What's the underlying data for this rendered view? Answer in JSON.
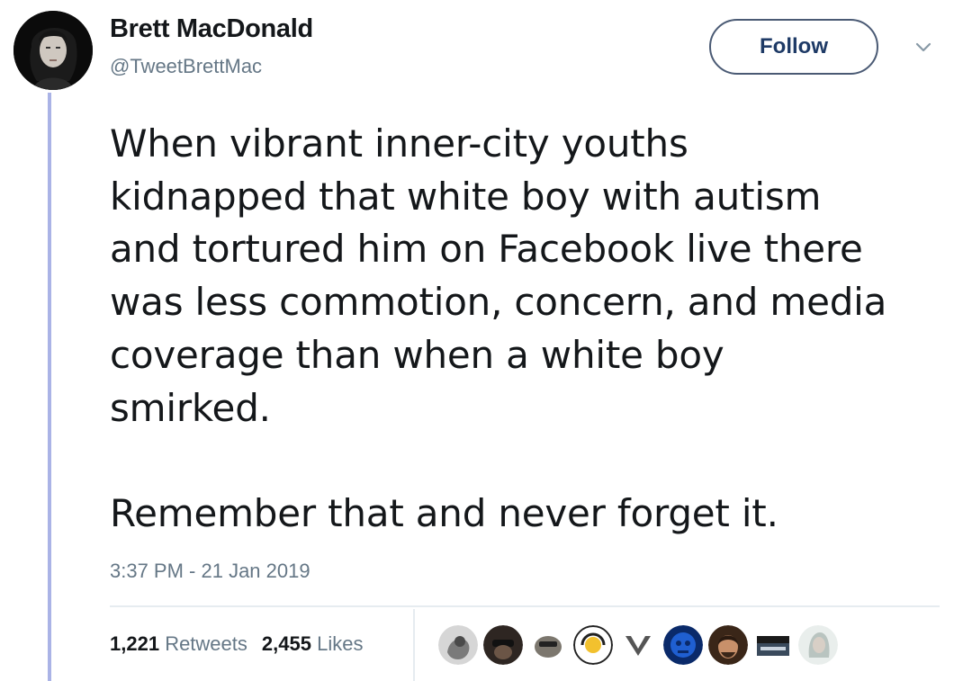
{
  "tweet": {
    "author": {
      "display_name": "Brett MacDonald",
      "handle": "@TweetBrettMac",
      "avatar": "user-avatar"
    },
    "follow_label": "Follow",
    "menu_icon": "chevron-down-icon",
    "text_lines": [
      "When vibrant inner-city youths",
      "kidnapped that white boy with autism",
      "and tortured him on Facebook live there",
      "was less commotion, concern, and media",
      "coverage than when a white boy",
      "smirked.",
      "",
      "Remember that and never forget it."
    ],
    "timestamp": "3:37 PM - 21 Jan 2019",
    "stats": {
      "retweets_count": "1,221",
      "retweets_label": "Retweets",
      "likes_count": "2,455",
      "likes_label": "Likes"
    },
    "likers": [
      {
        "name": "liker-avatar-1",
        "color": "#8a8a8a"
      },
      {
        "name": "liker-avatar-2",
        "color": "#3b2f2a"
      },
      {
        "name": "liker-avatar-3",
        "color": "#6d6a62"
      },
      {
        "name": "liker-avatar-4",
        "color": "#f2c12e"
      },
      {
        "name": "liker-avatar-5",
        "color": "#555555"
      },
      {
        "name": "liker-avatar-6",
        "color": "#1f5fd1"
      },
      {
        "name": "liker-avatar-7",
        "color": "#7a4a2c"
      },
      {
        "name": "liker-avatar-8",
        "color": "#3a4a5c"
      },
      {
        "name": "liker-avatar-9",
        "color": "#b9c4c0"
      }
    ],
    "colors": {
      "text": "#14171a",
      "secondary": "#657786",
      "thread_line": "#aab3e6",
      "follow_border": "#4a5a74"
    }
  }
}
